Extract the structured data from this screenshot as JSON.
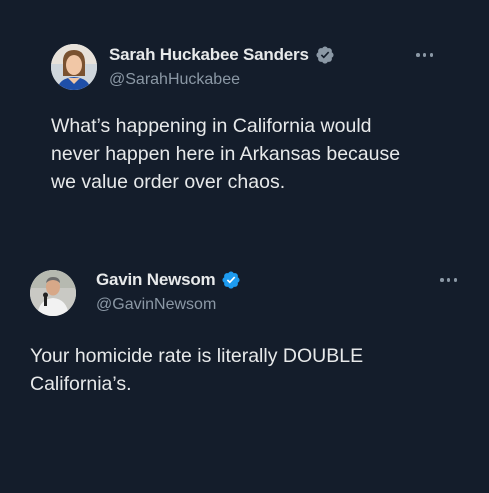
{
  "tweets": [
    {
      "display_name": "Sarah Huckabee Sanders",
      "handle": "@SarahHuckabee",
      "verified_color": "#8b98a5",
      "avatar_icon": "profile-photo-woman",
      "more_icon": "ellipsis-icon",
      "text": "What’s happening in California would\nnever happen here in Arkansas because\nwe value order over chaos."
    },
    {
      "display_name": "Gavin Newsom",
      "handle": "@GavinNewsom",
      "verified_color": "#1d9bf0",
      "avatar_icon": "profile-photo-man",
      "more_icon": "ellipsis-icon",
      "text": "Your homicide rate is literally DOUBLE\nCalifornia’s."
    }
  ],
  "colors": {
    "background": "#141d2b",
    "primary_text": "#e7e9ea",
    "secondary_text": "#8b98a5",
    "blue_check": "#1d9bf0",
    "gray_check": "#8b98a5"
  }
}
